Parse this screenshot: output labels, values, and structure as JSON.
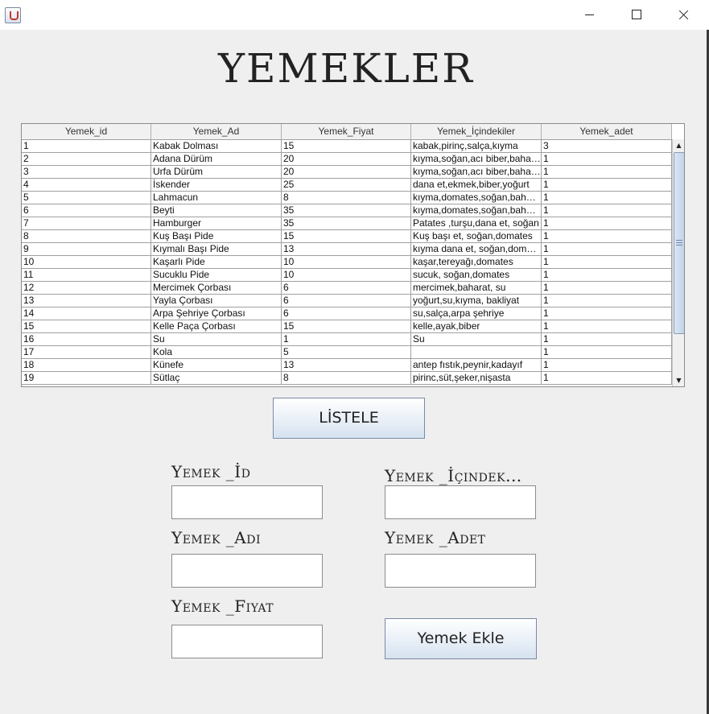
{
  "window": {
    "title": "",
    "minimize": "",
    "maximize": "",
    "close": ""
  },
  "heading": "YEMEKLER",
  "table": {
    "headers": [
      "Yemek_id",
      "Yemek_Ad",
      "Yemek_Fiyat",
      "Yemek_İçindekiler",
      "Yemek_adet"
    ],
    "rows": [
      [
        "1",
        "Kabak Dolması",
        "15",
        "kabak,pirinç,salça,kıyma",
        "3"
      ],
      [
        "2",
        "Adana Dürüm",
        "20",
        "kıyma,soğan,acı biber,baharat",
        "1"
      ],
      [
        "3",
        "Urfa Dürüm",
        "20",
        "kıyma,soğan,acı biber,baharat",
        "1"
      ],
      [
        "4",
        "İskender",
        "25",
        "dana et,ekmek,biber,yoğurt",
        "1"
      ],
      [
        "5",
        "Lahmacun",
        "8",
        "kıyma,domates,soğan,baharat",
        "1"
      ],
      [
        "6",
        "Beyti",
        "35",
        "kıyma,domates,soğan,baharat",
        "1"
      ],
      [
        "7",
        "Hamburger",
        "35",
        "Patates ,turşu,dana et, soğan",
        "1"
      ],
      [
        "8",
        "Kuş Başı Pide",
        "15",
        "Kuş başı et, soğan,domates",
        "1"
      ],
      [
        "9",
        "Kıymalı  Başı Pide",
        "13",
        "kıyma dana et, soğan,domates",
        "1"
      ],
      [
        "10",
        "Kaşarlı  Pide",
        "10",
        "kaşar,tereyağı,domates",
        "1"
      ],
      [
        "11",
        "Sucuklu Pide",
        "10",
        "sucuk, soğan,domates",
        "1"
      ],
      [
        "12",
        "Mercimek Çorbası",
        "6",
        "mercimek,baharat, su",
        "1"
      ],
      [
        "13",
        "Yayla Çorbası",
        "6",
        "yoğurt,su,kıyma, bakliyat",
        "1"
      ],
      [
        "14",
        "Arpa Şehriye  Çorbası",
        "6",
        "su,salça,arpa şehriye",
        "1"
      ],
      [
        "15",
        "Kelle Paça Çorbası",
        "15",
        "kelle,ayak,biber",
        "1"
      ],
      [
        "16",
        "Su",
        "1",
        "Su",
        "1"
      ],
      [
        "17",
        "Kola",
        "5",
        "",
        "1"
      ],
      [
        "18",
        "Künefe",
        "13",
        "antep fıstık,peynir,kadayıf",
        "1"
      ],
      [
        "19",
        "Sütlaç",
        "8",
        "pirinc,süt,şeker,nişasta",
        "1"
      ]
    ]
  },
  "buttons": {
    "list": "LİSTELE",
    "add": "Yemek Ekle"
  },
  "form": {
    "id_label": "Yemek _İd",
    "name_label": "Yemek _Adı",
    "price_label": "Yemek _Fiyat",
    "ingredients_label": "Yemek _İçindek...",
    "count_label": "Yemek _Adet",
    "id_value": "",
    "name_value": "",
    "price_value": "",
    "ingredients_value": "",
    "count_value": ""
  },
  "icons": {
    "app": "java-cup-icon",
    "scroll_up": "arrow-up-icon",
    "scroll_down": "arrow-down-icon"
  }
}
